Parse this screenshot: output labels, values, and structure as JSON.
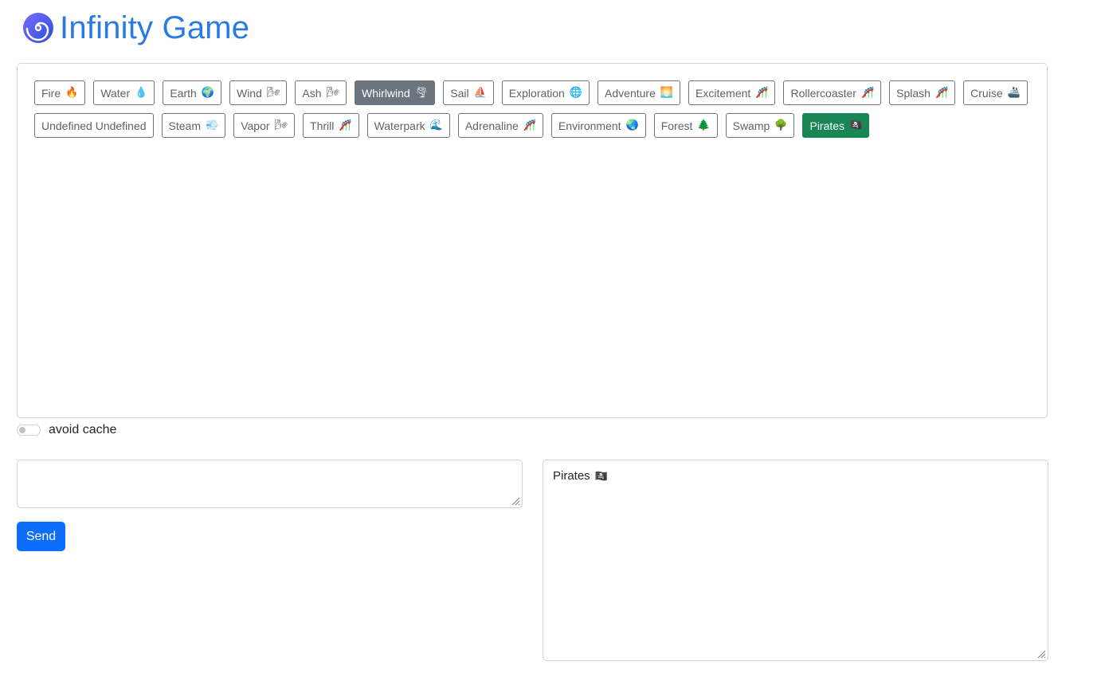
{
  "app": {
    "title": "Infinity Game",
    "logo_icon": "spiral-icon",
    "accent_color": "#2a7ae2"
  },
  "chips": [
    {
      "label": "Fire",
      "emoji": "🔥",
      "state": "default"
    },
    {
      "label": "Water",
      "emoji": "💧",
      "state": "default"
    },
    {
      "label": "Earth",
      "emoji": "🌍",
      "state": "default"
    },
    {
      "label": "Wind",
      "emoji": "🌬",
      "state": "default"
    },
    {
      "label": "Ash",
      "emoji": "🌬",
      "state": "default"
    },
    {
      "label": "Whirlwind",
      "emoji": "🌪",
      "state": "selected"
    },
    {
      "label": "Sail",
      "emoji": "⛵",
      "state": "default"
    },
    {
      "label": "Exploration",
      "emoji": "🌐",
      "state": "default"
    },
    {
      "label": "Adventure",
      "emoji": "🌅",
      "state": "default"
    },
    {
      "label": "Excitement",
      "emoji": "🎢",
      "state": "default"
    },
    {
      "label": "Rollercoaster",
      "emoji": "🎢",
      "state": "default"
    },
    {
      "label": "Splash",
      "emoji": "🎢",
      "state": "default"
    },
    {
      "label": "Cruise",
      "emoji": "🚢",
      "state": "default"
    },
    {
      "label": "Undefined Undefined",
      "emoji": "",
      "state": "default"
    },
    {
      "label": "Steam",
      "emoji": "💨",
      "state": "default"
    },
    {
      "label": "Vapor",
      "emoji": "🌬",
      "state": "default"
    },
    {
      "label": "Thrill",
      "emoji": "🎢",
      "state": "default"
    },
    {
      "label": "Waterpark",
      "emoji": "🌊",
      "state": "default"
    },
    {
      "label": "Adrenaline",
      "emoji": "🎢",
      "state": "default"
    },
    {
      "label": "Environment",
      "emoji": "🌏",
      "state": "default"
    },
    {
      "label": "Forest",
      "emoji": "🌲",
      "state": "default"
    },
    {
      "label": "Swamp",
      "emoji": "🌳",
      "state": "default"
    },
    {
      "label": "Pirates",
      "emoji": "🏴‍☠️",
      "state": "result"
    }
  ],
  "options": {
    "avoid_cache_label": "avoid cache",
    "avoid_cache_enabled": false
  },
  "input": {
    "value": "",
    "placeholder": ""
  },
  "send_button": {
    "label": "Send",
    "color": "#0d6efd"
  },
  "output": {
    "label": "Pirates",
    "emoji": "🏴‍☠️"
  },
  "colors": {
    "selected_chip": "#6c757d",
    "result_chip": "#198754"
  }
}
